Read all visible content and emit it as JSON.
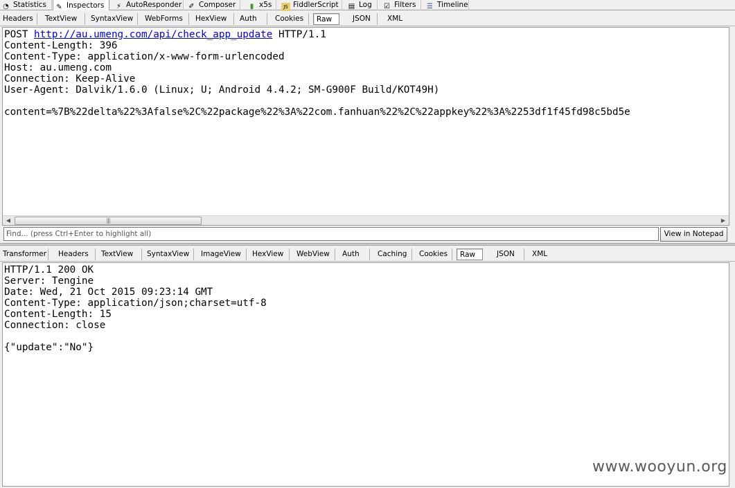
{
  "main_tabs": [
    {
      "label": "Statistics",
      "icon": "statistics-icon"
    },
    {
      "label": "Inspectors",
      "icon": "inspectors-icon",
      "active": true
    },
    {
      "label": "AutoResponder",
      "icon": "lightning-icon"
    },
    {
      "label": "Composer",
      "icon": "composer-icon"
    },
    {
      "label": "x5s",
      "icon": "x5s-icon"
    },
    {
      "label": "FiddlerScript",
      "icon": "script-icon"
    },
    {
      "label": "Log",
      "icon": "log-icon"
    },
    {
      "label": "Filters",
      "icon": "checkbox-icon"
    },
    {
      "label": "Timeline",
      "icon": "timeline-icon"
    }
  ],
  "request_tabs": [
    "Headers",
    "TextView",
    "SyntaxView",
    "WebForms",
    "HexView",
    "Auth",
    "Cookies",
    "Raw",
    "JSON",
    "XML"
  ],
  "request_active_tab": "Raw",
  "request": {
    "method": "POST",
    "url": "http://au.umeng.com/api/check_app_update",
    "protocol": "HTTP/1.1",
    "headers": [
      "Content-Length: 396",
      "Content-Type: application/x-www-form-urlencoded",
      "Host: au.umeng.com",
      "Connection: Keep-Alive",
      "User-Agent: Dalvik/1.6.0 (Linux; U; Android 4.4.2; SM-G900F Build/KOT49H)"
    ],
    "body": "content=%7B%22delta%22%3Afalse%2C%22package%22%3A%22com.fanhuan%22%2C%22appkey%22%3A%2253df1f45fd98c5bd5e"
  },
  "find": {
    "placeholder": "Find... (press Ctrl+Enter to highlight all)",
    "button_label": "View in Notepad"
  },
  "response_tabs": [
    "Transformer",
    "Headers",
    "TextView",
    "SyntaxView",
    "ImageView",
    "HexView",
    "WebView",
    "Auth",
    "Caching",
    "Cookies",
    "Raw",
    "JSON",
    "XML"
  ],
  "response_active_tab": "Raw",
  "response": {
    "lines": [
      "HTTP/1.1 200 OK",
      "Server: Tengine",
      "Date: Wed, 21 Oct 2015 09:23:14 GMT",
      "Content-Type: application/json;charset=utf-8",
      "Content-Length: 15",
      "Connection: close"
    ],
    "body": "{\"update\":\"No\"}"
  },
  "watermark": "www.wooyun.org",
  "colors": {
    "link": "#0000ee",
    "active_tab_bg": "#ffffff",
    "chrome_bg": "#f0f0f0"
  }
}
